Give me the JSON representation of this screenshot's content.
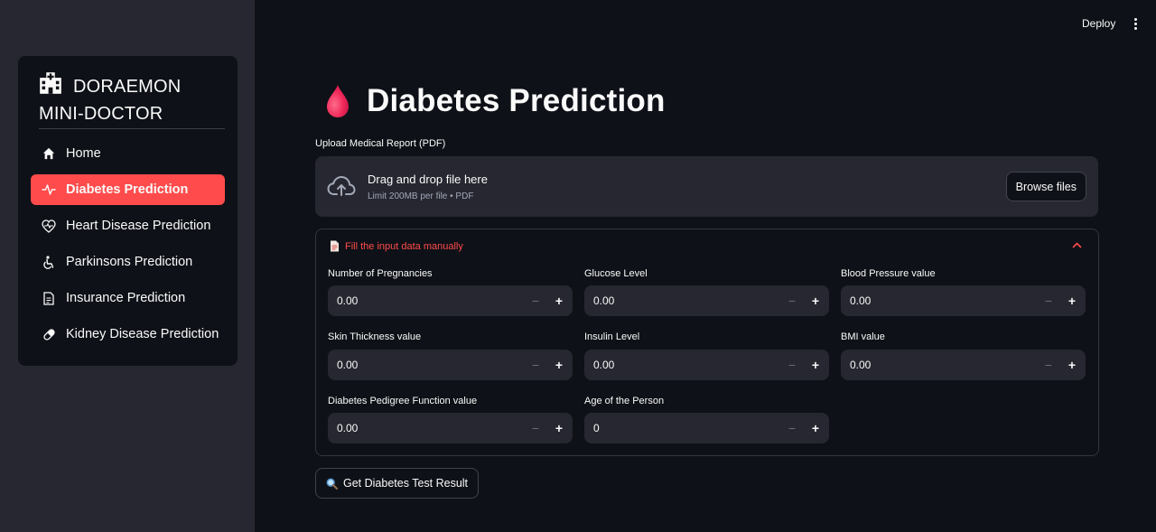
{
  "header": {
    "deploy_label": "Deploy"
  },
  "sidebar": {
    "brand_line1": "DORAEMON",
    "brand_line2": "MINI-DOCTOR",
    "items": [
      {
        "label": "Home",
        "icon": "house-icon",
        "active": false
      },
      {
        "label": "Diabetes Prediction",
        "icon": "activity-icon",
        "active": true
      },
      {
        "label": "Heart Disease Prediction",
        "icon": "heart-pulse-icon",
        "active": false
      },
      {
        "label": "Parkinsons Prediction",
        "icon": "wheelchair-icon",
        "active": false
      },
      {
        "label": "Insurance Prediction",
        "icon": "document-icon",
        "active": false
      },
      {
        "label": "Kidney Disease Prediction",
        "icon": "capsule-icon",
        "active": false
      }
    ]
  },
  "main": {
    "title": "Diabetes Prediction",
    "upload": {
      "label": "Upload Medical Report (PDF)",
      "drop_text": "Drag and drop file here",
      "limit_text": "Limit 200MB per file • PDF",
      "browse_label": "Browse files"
    },
    "expander": {
      "title": "Fill the input data manually",
      "fields": [
        {
          "label": "Number of Pregnancies",
          "value": "0.00"
        },
        {
          "label": "Glucose Level",
          "value": "0.00"
        },
        {
          "label": "Blood Pressure value",
          "value": "0.00"
        },
        {
          "label": "Skin Thickness value",
          "value": "0.00"
        },
        {
          "label": "Insulin Level",
          "value": "0.00"
        },
        {
          "label": "BMI value",
          "value": "0.00"
        },
        {
          "label": "Diabetes Pedigree Function value",
          "value": "0.00"
        },
        {
          "label": "Age of the Person",
          "value": "0"
        }
      ]
    },
    "submit_label": "Get Diabetes Test Result"
  },
  "colors": {
    "accent": "#ff4b4b",
    "background": "#0e1117",
    "sidebar": "#262730",
    "input": "#262730"
  }
}
